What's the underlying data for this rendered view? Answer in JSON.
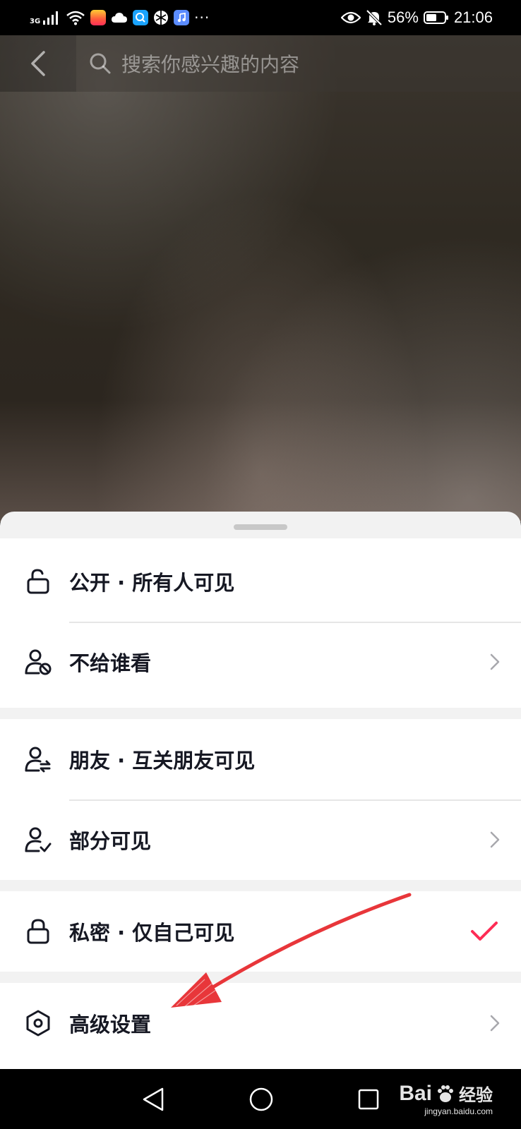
{
  "status_bar": {
    "network": "3G",
    "battery": "56%",
    "time": "21:06",
    "more": "···",
    "icons": [
      "signal-icon",
      "wifi-icon",
      "app-icon",
      "cloud-icon",
      "qq-browser-icon",
      "app-icon",
      "music-icon",
      "eye-icon",
      "mute-bell-icon",
      "battery-icon"
    ]
  },
  "search": {
    "placeholder": "搜索你感兴趣的内容"
  },
  "sheet": {
    "groups": [
      {
        "items": [
          {
            "label": "公开 · 所有人可见",
            "icon": "unlock-icon"
          },
          {
            "label": "不给谁看",
            "icon": "user-block-icon",
            "chevron": true
          }
        ]
      },
      {
        "items": [
          {
            "label": "朋友 · 互关朋友可见",
            "icon": "user-mutual-icon"
          },
          {
            "label": "部分可见",
            "icon": "user-check-icon",
            "chevron": true
          }
        ]
      },
      {
        "items": [
          {
            "label": "私密 · 仅自己可见",
            "icon": "lock-icon",
            "selected": true
          }
        ]
      },
      {
        "items": [
          {
            "label": "高级设置",
            "icon": "hex-settings-icon",
            "chevron": true
          }
        ]
      }
    ]
  },
  "colors": {
    "accent": "#fe2c55",
    "annotation": "#e8363a"
  },
  "watermark": {
    "brand": "Bai",
    "brand_suffix": "经验",
    "site": "jingyan.baidu.com"
  }
}
